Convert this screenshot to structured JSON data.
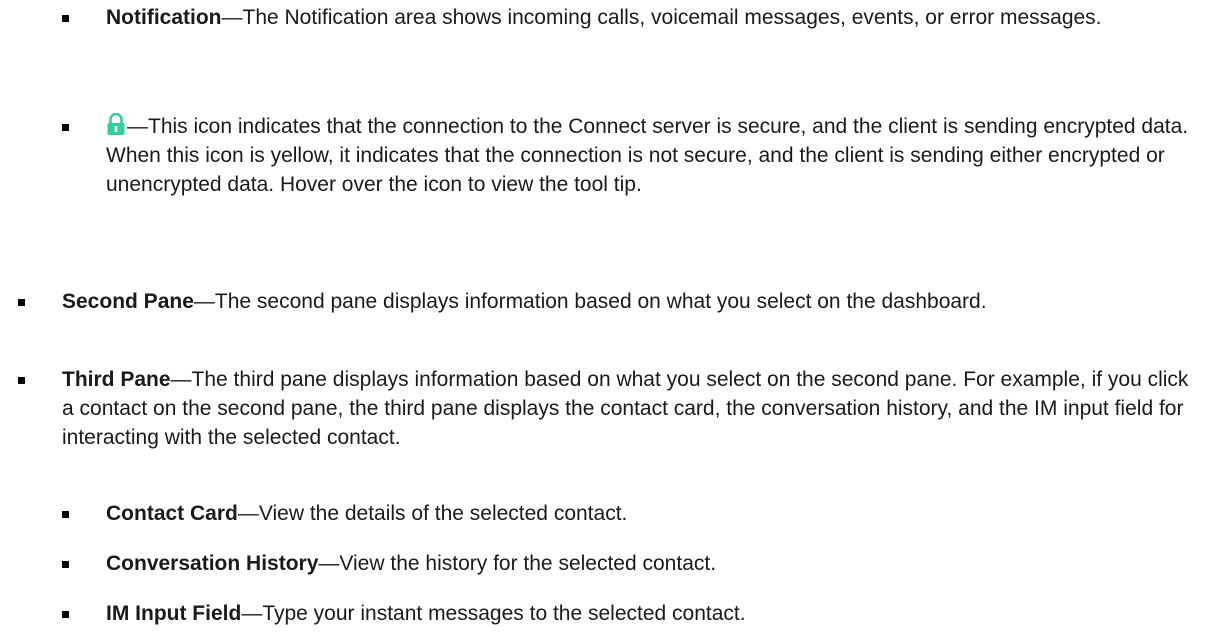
{
  "sublist_notification": {
    "title": "Notification",
    "dash": "—",
    "text": "The Notification area shows incoming calls, voicemail messages, events, or error messages."
  },
  "sublist_lock": {
    "icon": "lock-icon",
    "icon_color": "#33d19a",
    "dash": "—",
    "text": "This icon indicates that the connection to the Connect server is secure, and the client is sending encrypted data. When this icon is yellow, it indicates that the connection is not secure, and the client is sending either encrypted or unencrypted data. Hover over the icon to view the tool tip."
  },
  "second_pane": {
    "title": "Second Pane",
    "dash": "—",
    "text": "The second pane displays information based on what you select on the dashboard."
  },
  "third_pane": {
    "title": "Third Pane",
    "dash": "—",
    "text": "The third pane displays information based on what you select on the second pane. For example, if you click a contact on the second pane, the third pane displays the contact card, the conversation history, and the IM input field for interacting with the selected contact."
  },
  "contact_card": {
    "title": "Contact Card",
    "dash": "—",
    "text": "View the details of the selected contact."
  },
  "conversation_history": {
    "title": "Conversation History",
    "dash": "—",
    "text": "View the history for the selected contact."
  },
  "im_input_field": {
    "title": "IM Input Field",
    "dash": "—",
    "text": "Type your instant messages to the selected contact."
  }
}
